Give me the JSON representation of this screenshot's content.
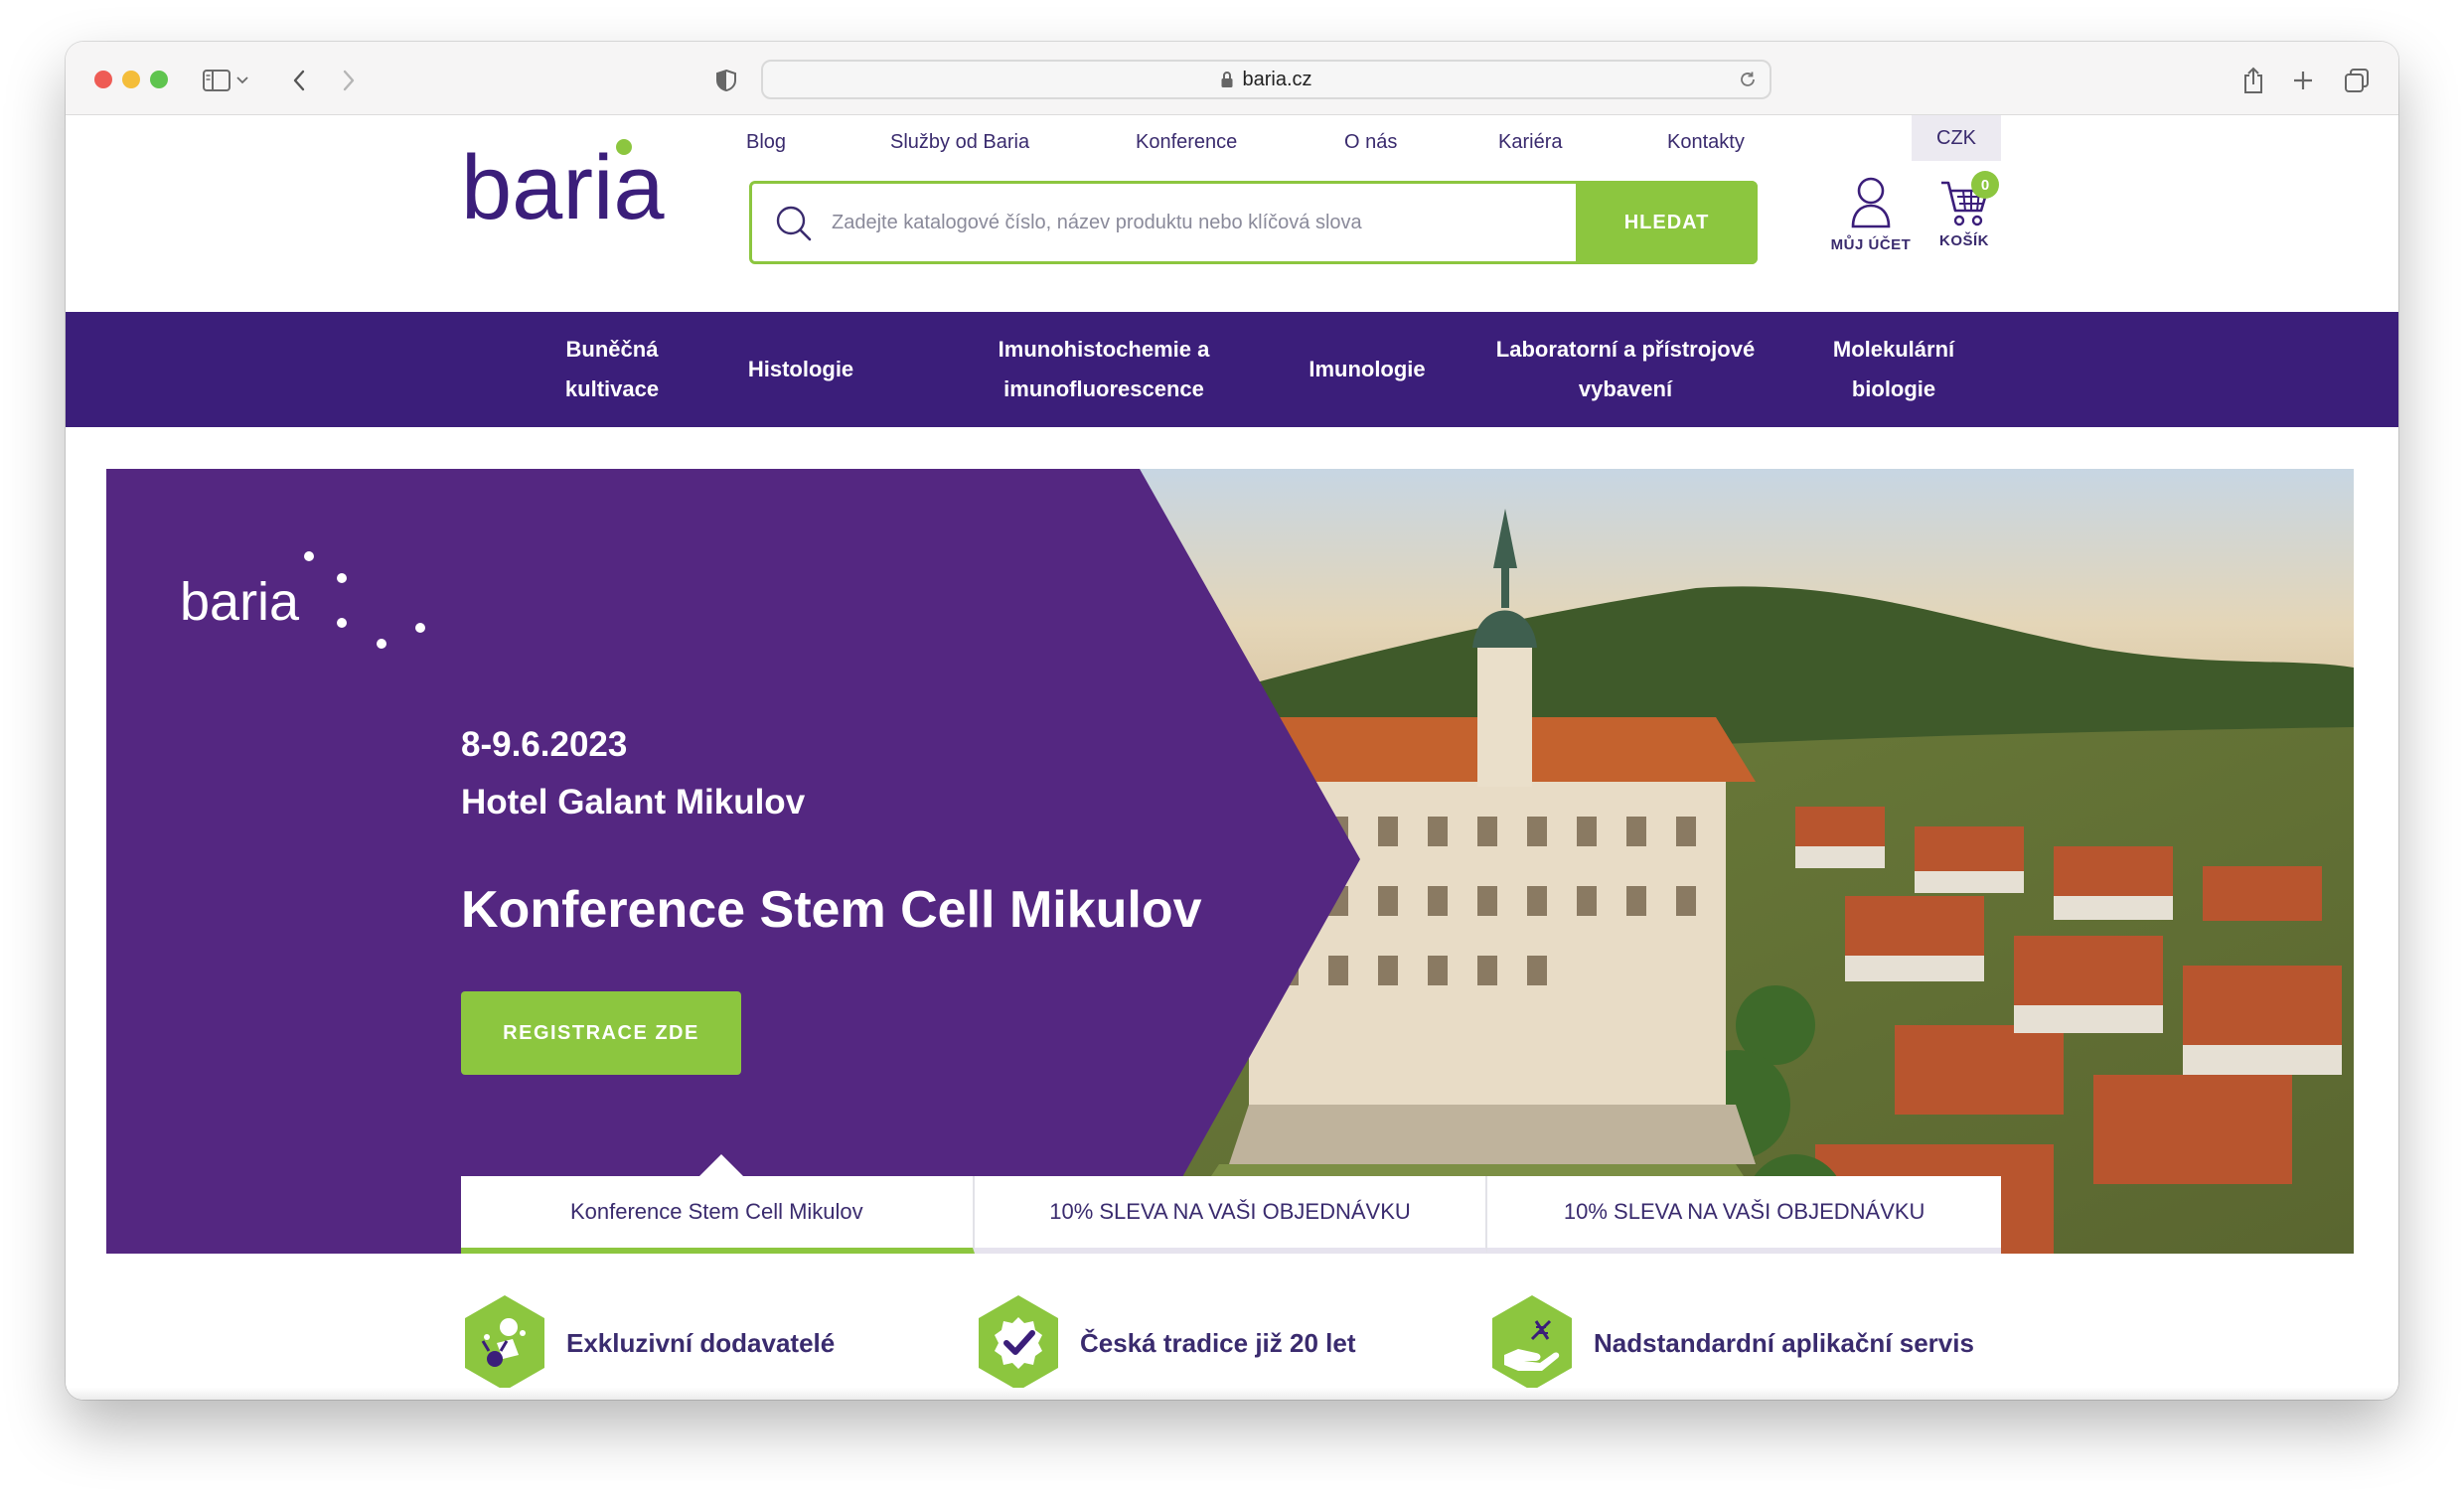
{
  "browser": {
    "url": "baria.cz"
  },
  "header": {
    "logo_text": "baria",
    "top_nav": [
      {
        "label": "Blog"
      },
      {
        "label": "Služby od Baria"
      },
      {
        "label": "Konference"
      },
      {
        "label": "O nás"
      },
      {
        "label": "Kariéra"
      },
      {
        "label": "Kontakty"
      }
    ],
    "currency": "CZK",
    "search": {
      "placeholder": "Zadejte katalogové číslo, název produktu nebo klíčová slova",
      "button_label": "HLEDAT"
    },
    "account_label": "MŮJ ÚČET",
    "cart_label": "KOŠÍK",
    "cart_count": "0"
  },
  "categories": [
    {
      "line1": "Buněčná",
      "line2": "kultivace"
    },
    {
      "line1": "Histologie",
      "line2": ""
    },
    {
      "line1": "Imunohistochemie a",
      "line2": "imunofluorescence"
    },
    {
      "line1": "Imunologie",
      "line2": ""
    },
    {
      "line1": "Laboratorní a přístrojové",
      "line2": "vybavení"
    },
    {
      "line1": "Molekulární",
      "line2": "biologie"
    }
  ],
  "hero": {
    "logo_text": "baria",
    "date": "8-9.6.2023",
    "venue": "Hotel Galant Mikulov",
    "title": "Konference Stem Cell Mikulov",
    "cta_label": "REGISTRACE ZDE",
    "tabs": [
      {
        "label": "Konference Stem Cell Mikulov",
        "active": true
      },
      {
        "label": "10% SLEVA NA VAŠI OBJEDNÁVKU",
        "active": false
      },
      {
        "label": "10% SLEVA NA VAŠI OBJEDNÁVKU",
        "active": false
      }
    ]
  },
  "features": [
    {
      "label": "Exkluzivní dodavatelé",
      "icon": "exclusive-suppliers-icon"
    },
    {
      "label": "Česká tradice již 20 let",
      "icon": "czech-tradition-icon"
    },
    {
      "label": "Nadstandardní aplikační servis",
      "icon": "application-service-icon"
    }
  ],
  "colors": {
    "brand_purple": "#3b1e7a",
    "hero_purple": "#542781",
    "accent_green": "#8cc63f",
    "text_dark": "#3a2b6e"
  }
}
